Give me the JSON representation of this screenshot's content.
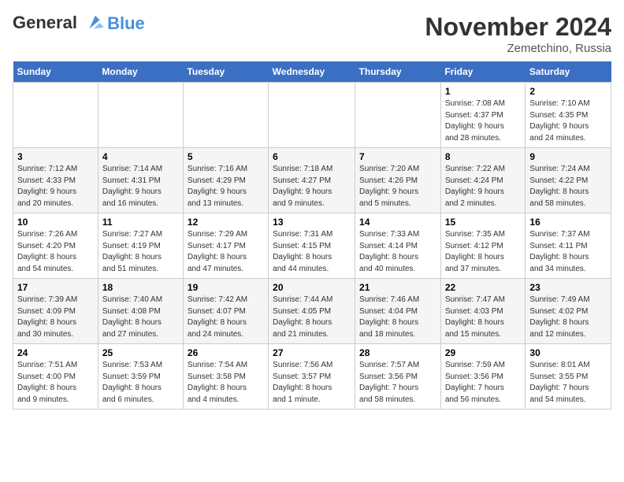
{
  "logo": {
    "line1": "General",
    "line2": "Blue"
  },
  "title": "November 2024",
  "location": "Zemetchino, Russia",
  "days_of_week": [
    "Sunday",
    "Monday",
    "Tuesday",
    "Wednesday",
    "Thursday",
    "Friday",
    "Saturday"
  ],
  "weeks": [
    [
      {
        "day": "",
        "info": ""
      },
      {
        "day": "",
        "info": ""
      },
      {
        "day": "",
        "info": ""
      },
      {
        "day": "",
        "info": ""
      },
      {
        "day": "",
        "info": ""
      },
      {
        "day": "1",
        "info": "Sunrise: 7:08 AM\nSunset: 4:37 PM\nDaylight: 9 hours\nand 28 minutes."
      },
      {
        "day": "2",
        "info": "Sunrise: 7:10 AM\nSunset: 4:35 PM\nDaylight: 9 hours\nand 24 minutes."
      }
    ],
    [
      {
        "day": "3",
        "info": "Sunrise: 7:12 AM\nSunset: 4:33 PM\nDaylight: 9 hours\nand 20 minutes."
      },
      {
        "day": "4",
        "info": "Sunrise: 7:14 AM\nSunset: 4:31 PM\nDaylight: 9 hours\nand 16 minutes."
      },
      {
        "day": "5",
        "info": "Sunrise: 7:16 AM\nSunset: 4:29 PM\nDaylight: 9 hours\nand 13 minutes."
      },
      {
        "day": "6",
        "info": "Sunrise: 7:18 AM\nSunset: 4:27 PM\nDaylight: 9 hours\nand 9 minutes."
      },
      {
        "day": "7",
        "info": "Sunrise: 7:20 AM\nSunset: 4:26 PM\nDaylight: 9 hours\nand 5 minutes."
      },
      {
        "day": "8",
        "info": "Sunrise: 7:22 AM\nSunset: 4:24 PM\nDaylight: 9 hours\nand 2 minutes."
      },
      {
        "day": "9",
        "info": "Sunrise: 7:24 AM\nSunset: 4:22 PM\nDaylight: 8 hours\nand 58 minutes."
      }
    ],
    [
      {
        "day": "10",
        "info": "Sunrise: 7:26 AM\nSunset: 4:20 PM\nDaylight: 8 hours\nand 54 minutes."
      },
      {
        "day": "11",
        "info": "Sunrise: 7:27 AM\nSunset: 4:19 PM\nDaylight: 8 hours\nand 51 minutes."
      },
      {
        "day": "12",
        "info": "Sunrise: 7:29 AM\nSunset: 4:17 PM\nDaylight: 8 hours\nand 47 minutes."
      },
      {
        "day": "13",
        "info": "Sunrise: 7:31 AM\nSunset: 4:15 PM\nDaylight: 8 hours\nand 44 minutes."
      },
      {
        "day": "14",
        "info": "Sunrise: 7:33 AM\nSunset: 4:14 PM\nDaylight: 8 hours\nand 40 minutes."
      },
      {
        "day": "15",
        "info": "Sunrise: 7:35 AM\nSunset: 4:12 PM\nDaylight: 8 hours\nand 37 minutes."
      },
      {
        "day": "16",
        "info": "Sunrise: 7:37 AM\nSunset: 4:11 PM\nDaylight: 8 hours\nand 34 minutes."
      }
    ],
    [
      {
        "day": "17",
        "info": "Sunrise: 7:39 AM\nSunset: 4:09 PM\nDaylight: 8 hours\nand 30 minutes."
      },
      {
        "day": "18",
        "info": "Sunrise: 7:40 AM\nSunset: 4:08 PM\nDaylight: 8 hours\nand 27 minutes."
      },
      {
        "day": "19",
        "info": "Sunrise: 7:42 AM\nSunset: 4:07 PM\nDaylight: 8 hours\nand 24 minutes."
      },
      {
        "day": "20",
        "info": "Sunrise: 7:44 AM\nSunset: 4:05 PM\nDaylight: 8 hours\nand 21 minutes."
      },
      {
        "day": "21",
        "info": "Sunrise: 7:46 AM\nSunset: 4:04 PM\nDaylight: 8 hours\nand 18 minutes."
      },
      {
        "day": "22",
        "info": "Sunrise: 7:47 AM\nSunset: 4:03 PM\nDaylight: 8 hours\nand 15 minutes."
      },
      {
        "day": "23",
        "info": "Sunrise: 7:49 AM\nSunset: 4:02 PM\nDaylight: 8 hours\nand 12 minutes."
      }
    ],
    [
      {
        "day": "24",
        "info": "Sunrise: 7:51 AM\nSunset: 4:00 PM\nDaylight: 8 hours\nand 9 minutes."
      },
      {
        "day": "25",
        "info": "Sunrise: 7:53 AM\nSunset: 3:59 PM\nDaylight: 8 hours\nand 6 minutes."
      },
      {
        "day": "26",
        "info": "Sunrise: 7:54 AM\nSunset: 3:58 PM\nDaylight: 8 hours\nand 4 minutes."
      },
      {
        "day": "27",
        "info": "Sunrise: 7:56 AM\nSunset: 3:57 PM\nDaylight: 8 hours\nand 1 minute."
      },
      {
        "day": "28",
        "info": "Sunrise: 7:57 AM\nSunset: 3:56 PM\nDaylight: 7 hours\nand 58 minutes."
      },
      {
        "day": "29",
        "info": "Sunrise: 7:59 AM\nSunset: 3:56 PM\nDaylight: 7 hours\nand 56 minutes."
      },
      {
        "day": "30",
        "info": "Sunrise: 8:01 AM\nSunset: 3:55 PM\nDaylight: 7 hours\nand 54 minutes."
      }
    ]
  ]
}
